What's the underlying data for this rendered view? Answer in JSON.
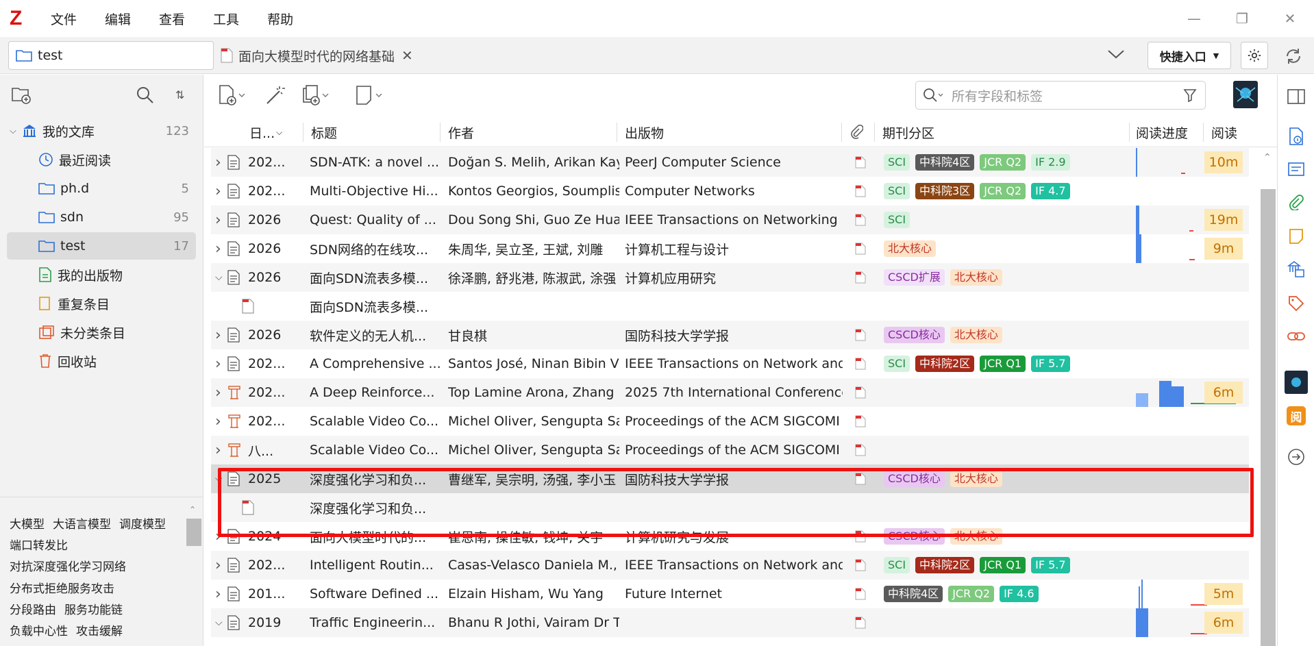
{
  "app": {
    "logo": "Z"
  },
  "menu": [
    "文件",
    "编辑",
    "查看",
    "工具",
    "帮助"
  ],
  "tabs": {
    "library_tab": "test",
    "doc_tab": "面向大模型时代的网络基础",
    "quick_entry": "快捷入口"
  },
  "sidebar": {
    "library": {
      "label": "我的文库",
      "count": "123"
    },
    "items": [
      {
        "label": "最近阅读",
        "count": ""
      },
      {
        "label": "ph.d",
        "count": "5"
      },
      {
        "label": "sdn",
        "count": "95"
      },
      {
        "label": "test",
        "count": "17"
      },
      {
        "label": "我的出版物",
        "count": ""
      },
      {
        "label": "重复条目",
        "count": ""
      },
      {
        "label": "未分类条目",
        "count": ""
      },
      {
        "label": "回收站",
        "count": ""
      }
    ]
  },
  "tags": [
    [
      "大模型",
      "大语言模型",
      "调度模型"
    ],
    [
      "端口转发比"
    ],
    [
      "对抗深度强化学习网络"
    ],
    [
      "分布式拒绝服务攻击"
    ],
    [
      "分段路由",
      "服务功能链"
    ],
    [
      "负载中心性",
      "攻击缓解"
    ]
  ],
  "search": {
    "placeholder": "所有字段和标签"
  },
  "columns": {
    "date": "日...",
    "title": "标题",
    "author": "作者",
    "publication": "出版物",
    "journal_rank": "期刊分区",
    "progress": "阅读进度",
    "read": "阅读"
  },
  "rows": [
    {
      "expanded": false,
      "child": false,
      "icon": "doc",
      "date": "202...",
      "title": "SDN-ATK: a novel ...",
      "author": "Doğan S. Melih, Arikan Kay",
      "pub": "PeerJ Computer Science",
      "pdf": true,
      "badges": [
        [
          "SCI",
          "b-sci"
        ],
        [
          "中科院4区",
          "b-cas4"
        ],
        [
          "JCR Q2",
          "b-jcr2"
        ],
        [
          "IF 2.9",
          "b-if29"
        ]
      ],
      "read": "10m",
      "alt": true
    },
    {
      "expanded": false,
      "child": false,
      "icon": "doc",
      "date": "202...",
      "title": "Multi-Objective Hi...",
      "author": "Kontos Georgios, Soumplis",
      "pub": "Computer Networks",
      "pdf": true,
      "badges": [
        [
          "SCI",
          "b-sci"
        ],
        [
          "中科院3区",
          "b-cas3"
        ],
        [
          "JCR Q2",
          "b-jcr2"
        ],
        [
          "IF 4.7",
          "b-if"
        ]
      ],
      "read": "",
      "alt": false
    },
    {
      "expanded": false,
      "child": false,
      "icon": "doc",
      "date": "2026",
      "title": "Quest: Quality of ...",
      "author": "Dou Song Shi, Guo Ze Hua",
      "pub": "IEEE Transactions on Networking",
      "pdf": true,
      "badges": [
        [
          "SCI",
          "b-sci"
        ]
      ],
      "read": "19m",
      "alt": true
    },
    {
      "expanded": false,
      "child": false,
      "icon": "doc",
      "date": "2026",
      "title": "SDN网络的在线攻...",
      "author": "朱周华, 吴立圣, 王斌, 刘雕",
      "pub": "计算机工程与设计",
      "pdf": true,
      "badges": [
        [
          "北大核心",
          "b-pku"
        ]
      ],
      "read": "9m",
      "alt": false
    },
    {
      "expanded": true,
      "child": false,
      "icon": "doc",
      "date": "2026",
      "title": "面向SDN流表多模...",
      "author": "徐泽鹏, 舒兆港, 陈淑武, 涂强",
      "pub": "计算机应用研究",
      "pdf": true,
      "badges": [
        [
          "CSCD扩展",
          "b-cscdx"
        ],
        [
          "北大核心",
          "b-pku"
        ]
      ],
      "read": "",
      "alt": true
    },
    {
      "expanded": false,
      "child": true,
      "icon": "pdf",
      "date": "",
      "title": "面向SDN流表多模...",
      "author": "",
      "pub": "",
      "pdf": false,
      "badges": [],
      "read": "",
      "alt": false
    },
    {
      "expanded": false,
      "child": false,
      "icon": "doc",
      "date": "2026",
      "title": "软件定义的无人机...",
      "author": "甘良棋",
      "pub": "国防科技大学学报",
      "pdf": true,
      "badges": [
        [
          "CSCD核心",
          "b-cscd"
        ],
        [
          "北大核心",
          "b-pku"
        ]
      ],
      "read": "",
      "alt": true
    },
    {
      "expanded": false,
      "child": false,
      "icon": "doc",
      "date": "202...",
      "title": "A Comprehensive ...",
      "author": "Santos José, Ninan Bibin V",
      "pub": "IEEE Transactions on Network and",
      "pdf": true,
      "badges": [
        [
          "SCI",
          "b-sci"
        ],
        [
          "中科院2区",
          "b-cas2"
        ],
        [
          "JCR Q1",
          "b-jcr1"
        ],
        [
          "IF 5.7",
          "b-if"
        ]
      ],
      "read": "",
      "alt": false
    },
    {
      "expanded": false,
      "child": false,
      "icon": "conf",
      "date": "202...",
      "title": "A Deep Reinforce...",
      "author": "Top Lamine Arona, Zhang",
      "pub": "2025 7th International Conference",
      "pdf": true,
      "badges": [],
      "read": "6m",
      "alt": true
    },
    {
      "expanded": false,
      "child": false,
      "icon": "conf",
      "date": "202...",
      "title": "Scalable Video Co...",
      "author": "Michel Oliver, Sengupta Sa",
      "pub": "Proceedings of the ACM SIGCOMI",
      "pdf": true,
      "badges": [],
      "read": "",
      "alt": false
    },
    {
      "expanded": false,
      "child": false,
      "icon": "conf",
      "date": "八...",
      "title": "Scalable Video Co...",
      "author": "Michel Oliver, Sengupta Sa",
      "pub": "Proceedings of the ACM SIGCOMI",
      "pdf": true,
      "badges": [],
      "read": "",
      "alt": true
    },
    {
      "expanded": true,
      "child": false,
      "icon": "doc",
      "date": "2025",
      "title": "深度强化学习和负...",
      "author": "曹继军, 吴宗明, 汤强, 李小玉",
      "pub": "国防科技大学学报",
      "pdf": true,
      "badges": [
        [
          "CSCD核心",
          "b-cscd"
        ],
        [
          "北大核心",
          "b-pku"
        ]
      ],
      "read": "",
      "alt": false,
      "selected": true
    },
    {
      "expanded": false,
      "child": true,
      "icon": "pdf",
      "date": "",
      "title": "深度强化学习和负...",
      "author": "",
      "pub": "",
      "pdf": false,
      "badges": [],
      "read": "",
      "alt": true
    },
    {
      "expanded": false,
      "child": false,
      "icon": "doc",
      "date": "2024",
      "title": "面向大模型时代的...",
      "author": "崔恩南, 操佳敏, 钱坤, 关宇",
      "pub": "计算机研究与发展",
      "pdf": true,
      "badges": [
        [
          "CSCD核心",
          "b-cscd"
        ],
        [
          "北大核心",
          "b-pku"
        ]
      ],
      "read": "",
      "alt": false
    },
    {
      "expanded": false,
      "child": false,
      "icon": "doc",
      "date": "202...",
      "title": "Intelligent Routin...",
      "author": "Casas-Velasco Daniela M.,",
      "pub": "IEEE Transactions on Network and",
      "pdf": true,
      "badges": [
        [
          "SCI",
          "b-sci"
        ],
        [
          "中科院2区",
          "b-cas2"
        ],
        [
          "JCR Q1",
          "b-jcr1"
        ],
        [
          "IF 5.7",
          "b-if"
        ]
      ],
      "read": "",
      "alt": true
    },
    {
      "expanded": false,
      "child": false,
      "icon": "doc",
      "date": "201...",
      "title": "Software Defined ...",
      "author": "Elzain Hisham, Wu Yang",
      "pub": "Future Internet",
      "pdf": true,
      "badges": [
        [
          "中科院4区",
          "b-cas4"
        ],
        [
          "JCR Q2",
          "b-jcr2"
        ],
        [
          "IF 4.6",
          "b-if"
        ]
      ],
      "read": "5m",
      "alt": false
    },
    {
      "expanded": true,
      "child": false,
      "icon": "doc",
      "date": "2019",
      "title": "Traffic Engineerin...",
      "author": "Bhanu R Jothi, Vairam Dr T",
      "pub": "",
      "pdf": true,
      "badges": [],
      "read": "6m",
      "alt": true
    }
  ]
}
